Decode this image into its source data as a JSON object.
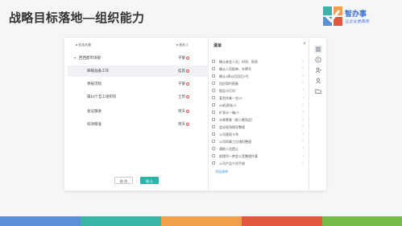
{
  "slide": {
    "title": "战略目标落地—组织能力"
  },
  "logo": {
    "name": "智办事",
    "slogan": "让企业更高效"
  },
  "table": {
    "headers": {
      "name": "▾ 任务名称",
      "owner": "▾ 责任人"
    },
    "rows": [
      {
        "name": "西西郡市场部",
        "owner": "子豪",
        "caret": "▾"
      },
      {
        "name": "邮箱准备工作",
        "owner": "桂思"
      },
      {
        "name": "季报流程",
        "owner": "子豪"
      },
      {
        "name": "属10个互工组织料",
        "owner": "士周"
      },
      {
        "name": "会议跟进",
        "owner": "周天"
      },
      {
        "name": "投效服准",
        "owner": "周天"
      }
    ]
  },
  "buttons": {
    "cancel": "取 消",
    "ok": "确 认"
  },
  "panel": {
    "title": "清单",
    "close": "×",
    "items": [
      "确认参会人员、时间、职责",
      "确认人员报单、车牌号",
      "确认1周以后回后2号",
      "回应简约报备",
      "报告卡打印",
      "某些作者一名/人",
      "A4机两张/人",
      "矿泉水一箱/人",
      "水果零食（根人数而定）",
      "会议现场指导整理",
      "公司理现卡净",
      "公司同事工位诸扣整理",
      "通航人员提让",
      "前理列一转会公室整理作基",
      "公司产品介绍手册"
    ],
    "add_link": "添加清单",
    "remove": "×"
  },
  "toolbar": {
    "icons": [
      "list-icon",
      "info-icon",
      "user-edit-icon",
      "user-icon",
      "folder-icon"
    ]
  },
  "colors": {
    "accent": "#29b5ad",
    "bar": [
      "#5b8fd6",
      "#3bb5a8",
      "#f0a04b",
      "#e2573f",
      "#78b94b"
    ]
  }
}
